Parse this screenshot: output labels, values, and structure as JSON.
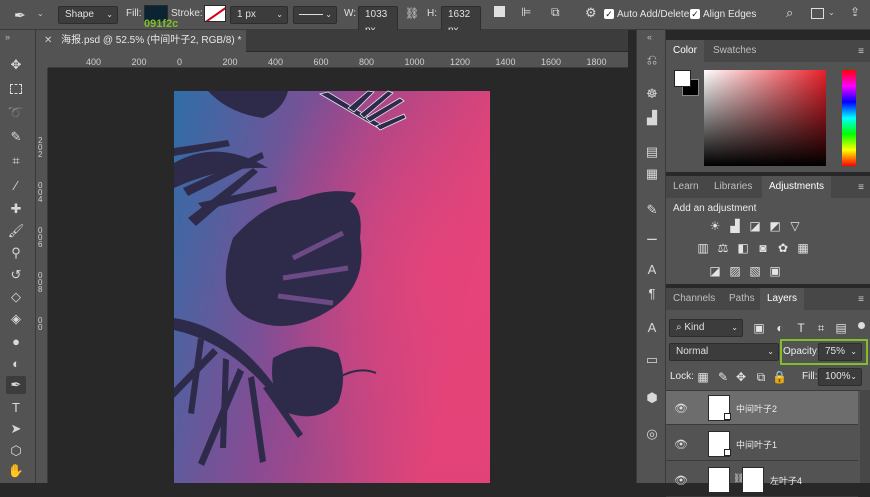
{
  "options": {
    "mode": "Shape",
    "fill_label": "Fill:",
    "fill_hex": "091f2c",
    "stroke_label": "Stroke:",
    "stroke_width": "1 px",
    "w_label": "W:",
    "w_value": "1033 px",
    "h_label": "H:",
    "h_value": "1632 px",
    "auto_add_delete": "Auto Add/Delete",
    "align_edges": "Align Edges",
    "fill_color": "#0b2333"
  },
  "document": {
    "tab_title": "海报.psd @ 52.5% (中间叶子2, RGB/8) *",
    "ruler_labels": [
      "400",
      "200",
      "0",
      "200",
      "400",
      "600",
      "800",
      "1000",
      "1200",
      "1400",
      "1600",
      "1800"
    ],
    "vruler_labels": [
      "2",
      "0",
      "2",
      "0",
      "0",
      "4",
      "0",
      "0",
      "6",
      "0",
      "0",
      "8",
      "0",
      "0"
    ]
  },
  "panels": {
    "color_tabs": [
      "Color",
      "Swatches"
    ],
    "adjust_tabs": [
      "Learn",
      "Libraries",
      "Adjustments"
    ],
    "add_adjustment": "Add an adjustment",
    "layer_tabs": [
      "Channels",
      "Paths",
      "Layers"
    ],
    "kind": "Kind",
    "blend_mode": "Normal",
    "opacity_label": "Opacity:",
    "opacity_value": "75%",
    "lock_label": "Lock:",
    "fill_label": "Fill:",
    "fill_value": "100%",
    "layers": [
      {
        "name": "中间叶子2",
        "selected": true
      },
      {
        "name": "中间叶子1",
        "selected": false
      },
      {
        "name": "左叶子4",
        "selected": false
      }
    ]
  },
  "colors": {
    "poster_blue": "#2f6ea8",
    "poster_pink": "#e24377",
    "leaf": "#2e2b4a",
    "highlight": "#7fbf2a"
  }
}
